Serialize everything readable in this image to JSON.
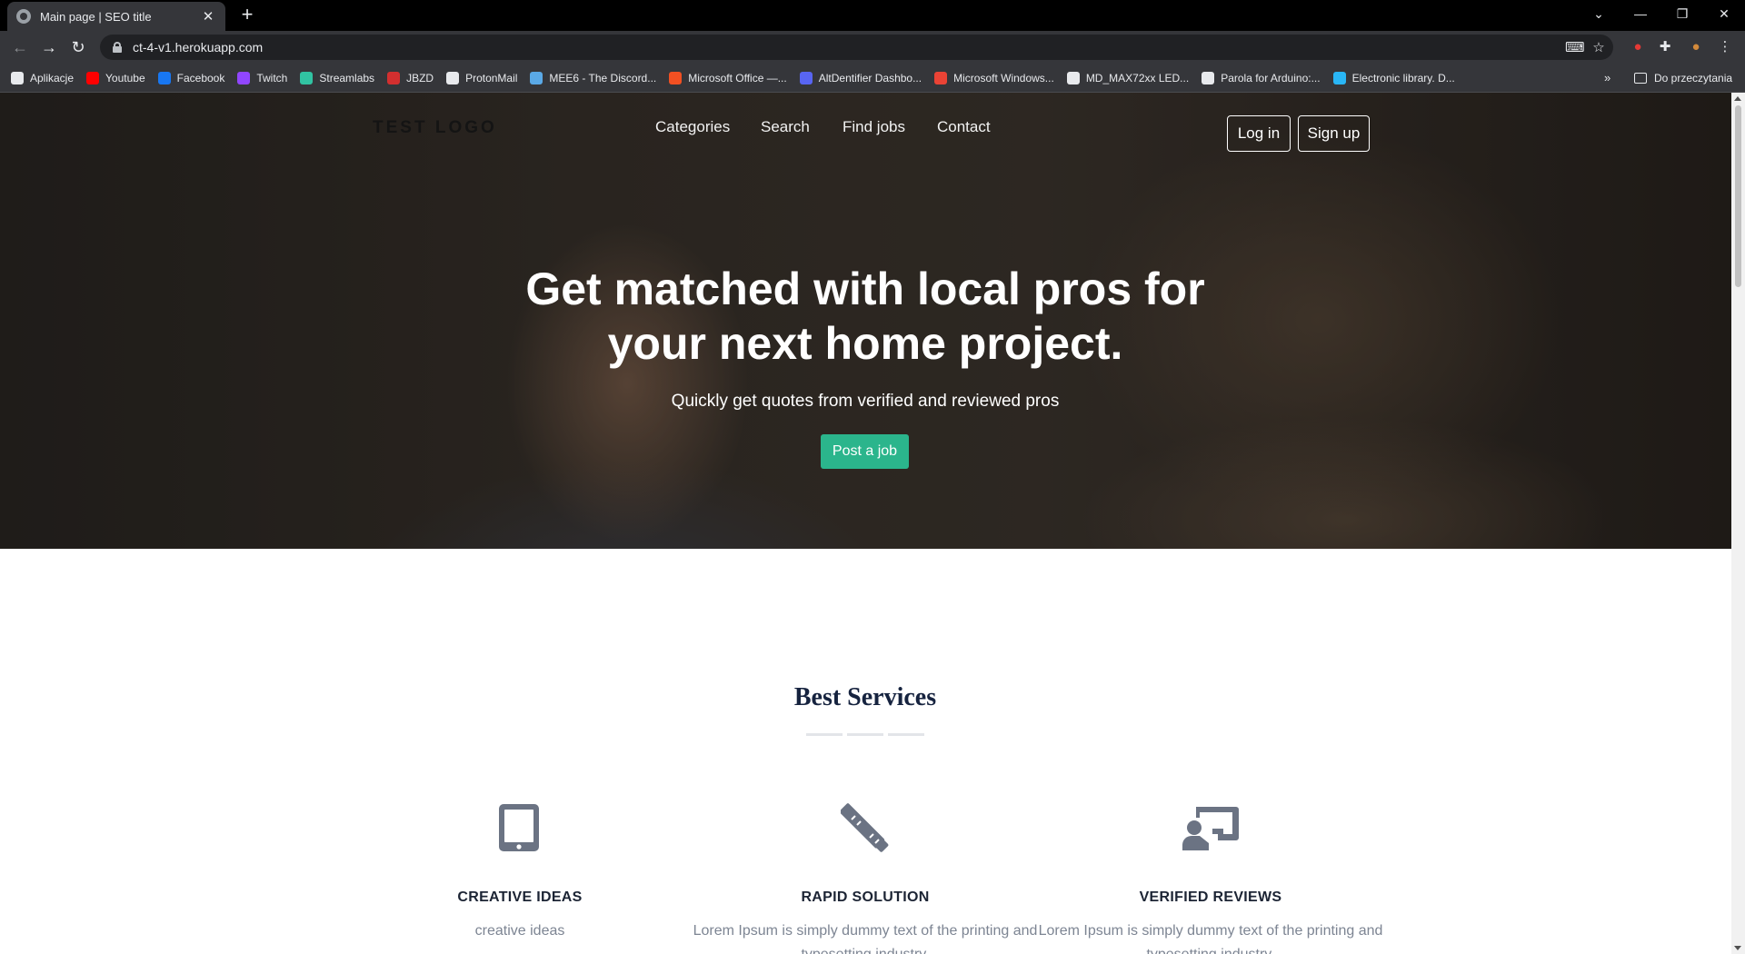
{
  "browser": {
    "tab_title": "Main page | SEO title",
    "url": "ct-4-v1.herokuapp.com",
    "bookmarks": [
      {
        "label": "Aplikacje",
        "color": "#e8eaed"
      },
      {
        "label": "Youtube",
        "color": "#ff0000"
      },
      {
        "label": "Facebook",
        "color": "#1877f2"
      },
      {
        "label": "Twitch",
        "color": "#9146ff"
      },
      {
        "label": "Streamlabs",
        "color": "#31c3a2"
      },
      {
        "label": "JBZD",
        "color": "#d32f2f"
      },
      {
        "label": "ProtonMail",
        "color": "#e8eaed"
      },
      {
        "label": "MEE6 - The Discord...",
        "color": "#5aa9e6"
      },
      {
        "label": "Microsoft Office —...",
        "color": "#f25022"
      },
      {
        "label": "AltDentifier Dashbo...",
        "color": "#5865f2"
      },
      {
        "label": "Microsoft Windows...",
        "color": "#ea4335"
      },
      {
        "label": "MD_MAX72xx LED...",
        "color": "#e8eaed"
      },
      {
        "label": "Parola for Arduino:...",
        "color": "#e8eaed"
      },
      {
        "label": "Electronic library. D...",
        "color": "#29b6f6"
      }
    ],
    "more_bookmarks": "»",
    "reading_list": "Do przeczytania"
  },
  "site": {
    "logo": "TEST LOGO",
    "nav": [
      "Categories",
      "Search",
      "Find jobs",
      "Contact"
    ],
    "login": "Log in",
    "signup": "Sign up",
    "hero_title": "Get matched with local pros for your next home project.",
    "hero_subtitle": "Quickly get quotes from verified and reviewed pros",
    "cta": "Post a job",
    "section_title": "Best Services",
    "services": [
      {
        "icon": "tablet-icon",
        "title": "CREATIVE IDEAS",
        "text": "creative ideas"
      },
      {
        "icon": "pencil-ruler-icon",
        "title": "RAPID SOLUTION",
        "text": "Lorem Ipsum is simply dummy text of the printing and typesetting industry."
      },
      {
        "icon": "chalkboard-teacher-icon",
        "title": "VERIFIED REVIEWS",
        "text": "Lorem Ipsum is simply dummy text of the printing and typesetting industry."
      }
    ]
  },
  "colors": {
    "accent": "#2bb58c",
    "heading": "#16233f",
    "icon": "#6b7383",
    "muted": "#7d8593"
  }
}
